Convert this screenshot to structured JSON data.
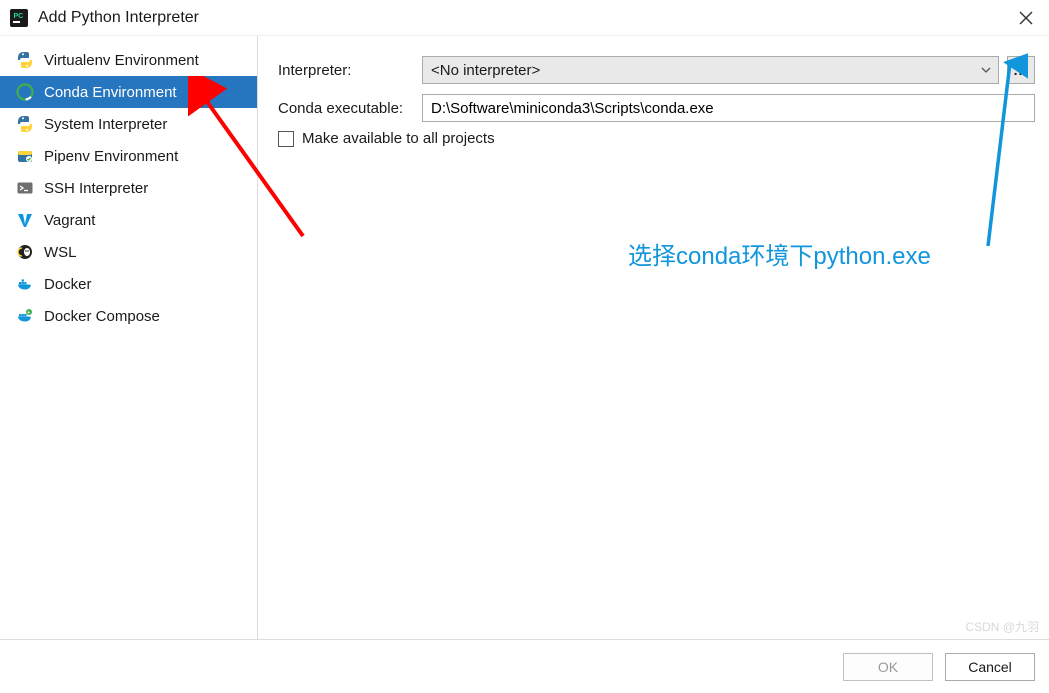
{
  "window": {
    "title": "Add Python Interpreter"
  },
  "sidebar": {
    "items": [
      {
        "label": "Virtualenv Environment",
        "icon": "python-icon",
        "selected": false
      },
      {
        "label": "Conda Environment",
        "icon": "conda-icon",
        "selected": true
      },
      {
        "label": "System Interpreter",
        "icon": "python-icon",
        "selected": false
      },
      {
        "label": "Pipenv Environment",
        "icon": "pipenv-icon",
        "selected": false
      },
      {
        "label": "SSH Interpreter",
        "icon": "ssh-icon",
        "selected": false
      },
      {
        "label": "Vagrant",
        "icon": "vagrant-icon",
        "selected": false
      },
      {
        "label": "WSL",
        "icon": "wsl-icon",
        "selected": false
      },
      {
        "label": "Docker",
        "icon": "docker-icon",
        "selected": false
      },
      {
        "label": "Docker Compose",
        "icon": "docker-compose-icon",
        "selected": false
      }
    ]
  },
  "form": {
    "interpreter_label": "Interpreter:",
    "interpreter_value": "<No interpreter>",
    "browse_label": "...",
    "conda_exec_label": "Conda executable:",
    "conda_exec_value": "D:\\Software\\miniconda3\\Scripts\\conda.exe",
    "make_available_label": "Make available to all projects",
    "make_available_checked": false
  },
  "annotation": {
    "text": "选择conda环境下python.exe"
  },
  "footer": {
    "ok_label": "OK",
    "cancel_label": "Cancel",
    "ok_enabled": false
  },
  "watermark": "CSDN @九羽"
}
